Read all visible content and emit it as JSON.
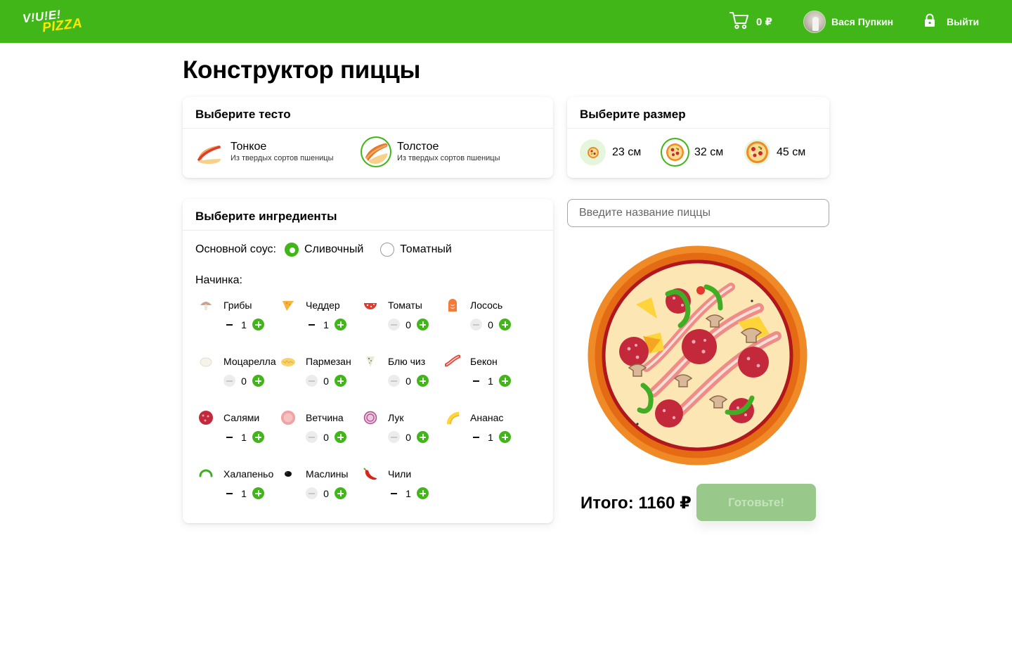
{
  "header": {
    "logo_line1": "V!U!E!",
    "logo_line2": "PIZZA",
    "cart_sum": "0 ₽",
    "user_name": "Вася Пупкин",
    "logout_label": "Выйти"
  },
  "page": {
    "title": "Конструктор пиццы"
  },
  "dough": {
    "title": "Выберите тесто",
    "options": [
      {
        "name": "Тонкое",
        "desc": "Из твердых сортов пшеницы",
        "selected": false
      },
      {
        "name": "Толстое",
        "desc": "Из твердых сортов пшеницы",
        "selected": true
      }
    ]
  },
  "size": {
    "title": "Выберите размер",
    "options": [
      {
        "label": "23 см",
        "selected": false
      },
      {
        "label": "32 см",
        "selected": true
      },
      {
        "label": "45 см",
        "selected": false
      }
    ]
  },
  "ingredients": {
    "title": "Выберите ингредиенты",
    "sauce_label": "Основной соус:",
    "sauces": [
      {
        "label": "Сливочный",
        "checked": true
      },
      {
        "label": "Томатный",
        "checked": false
      }
    ],
    "filling_label": "Начинка:",
    "items": [
      {
        "name": "Грибы",
        "count": "1",
        "icon": "mushroom-icon"
      },
      {
        "name": "Чеддер",
        "count": "1",
        "icon": "cheddar-icon"
      },
      {
        "name": "Томаты",
        "count": "0",
        "icon": "tomato-icon"
      },
      {
        "name": "Лосось",
        "count": "0",
        "icon": "salmon-icon"
      },
      {
        "name": "Моцарелла",
        "count": "0",
        "icon": "mozzarella-icon"
      },
      {
        "name": "Пармезан",
        "count": "0",
        "icon": "parmesan-icon"
      },
      {
        "name": "Блю чиз",
        "count": "0",
        "icon": "blue-cheese-icon"
      },
      {
        "name": "Бекон",
        "count": "1",
        "icon": "bacon-icon"
      },
      {
        "name": "Салями",
        "count": "1",
        "icon": "salami-icon"
      },
      {
        "name": "Ветчина",
        "count": "0",
        "icon": "ham-icon"
      },
      {
        "name": "Лук",
        "count": "0",
        "icon": "onion-icon"
      },
      {
        "name": "Ананас",
        "count": "1",
        "icon": "pineapple-icon"
      },
      {
        "name": "Халапеньо",
        "count": "1",
        "icon": "jalapeno-icon"
      },
      {
        "name": "Маслины",
        "count": "0",
        "icon": "olive-icon"
      },
      {
        "name": "Чили",
        "count": "1",
        "icon": "chili-icon"
      }
    ]
  },
  "builder": {
    "name_placeholder": "Введите название пиццы",
    "total": "Итого: 1160 ₽",
    "cook_label": "Готовьте!"
  },
  "colors": {
    "brand_green": "#41b619",
    "logo_yellow": "#ffe600",
    "disabled_button": "#98c98a"
  }
}
